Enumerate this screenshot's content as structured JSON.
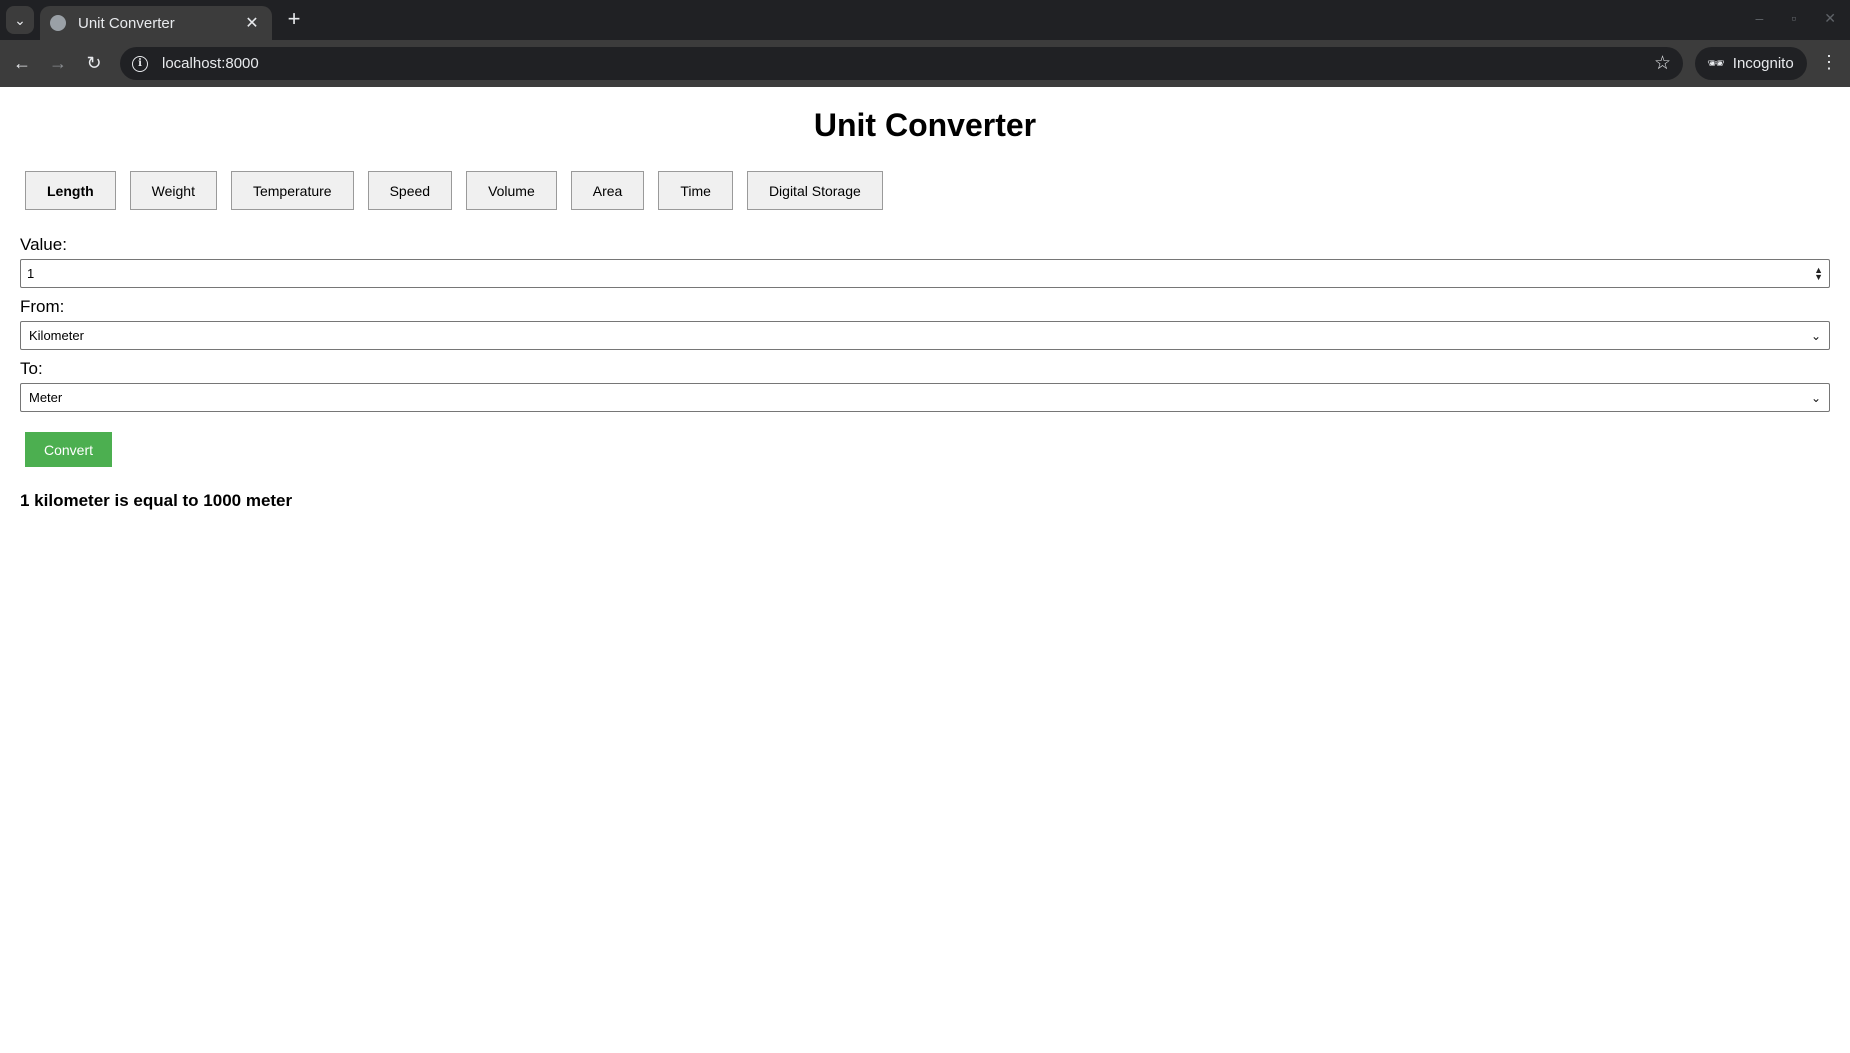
{
  "browser": {
    "tab_title": "Unit Converter",
    "new_tab_symbol": "+",
    "url": "localhost:8000",
    "profile_label": "Incognito"
  },
  "page": {
    "title": "Unit Converter",
    "categories": [
      {
        "label": "Length",
        "active": true
      },
      {
        "label": "Weight"
      },
      {
        "label": "Temperature"
      },
      {
        "label": "Speed"
      },
      {
        "label": "Volume"
      },
      {
        "label": "Area"
      },
      {
        "label": "Time"
      },
      {
        "label": "Digital Storage"
      }
    ],
    "value_label": "Value:",
    "value": "1",
    "from_label": "From:",
    "from_selected": "Kilometer",
    "to_label": "To:",
    "to_selected": "Meter",
    "convert_label": "Convert",
    "result_text": "1 kilometer is equal to 1000 meter"
  },
  "colors": {
    "convert_button": "#4caf50",
    "chrome_dark": "#202124",
    "chrome_toolbar": "#3c3c3c"
  }
}
